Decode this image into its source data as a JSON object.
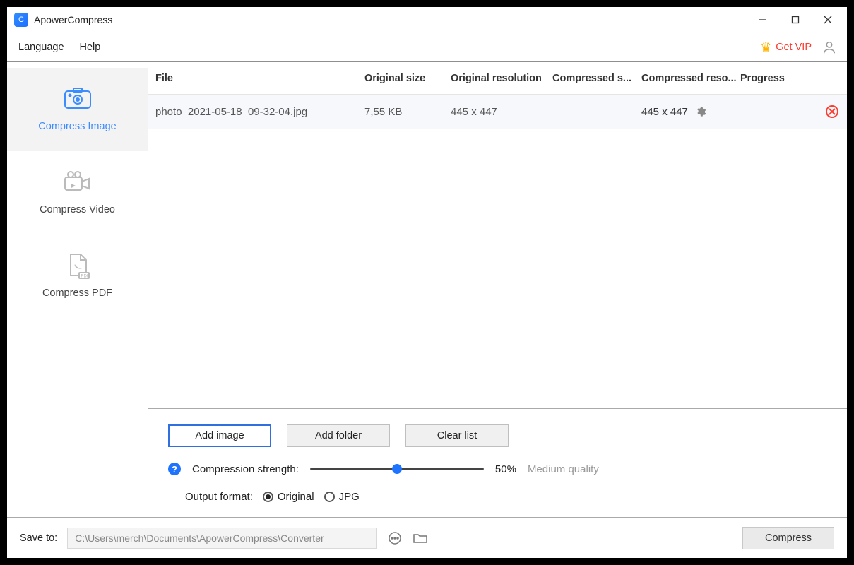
{
  "app": {
    "title": "ApowerCompress"
  },
  "window_controls": {
    "minimize": "min",
    "maximize": "max",
    "close": "close"
  },
  "menubar": {
    "items": [
      "Language",
      "Help"
    ],
    "vip_label": "Get VIP"
  },
  "sidebar": {
    "items": [
      {
        "label": "Compress Image",
        "icon": "camera-icon",
        "active": true
      },
      {
        "label": "Compress Video",
        "icon": "video-icon",
        "active": false
      },
      {
        "label": "Compress PDF",
        "icon": "pdf-icon",
        "active": false
      }
    ]
  },
  "table": {
    "headers": {
      "file": "File",
      "original_size": "Original size",
      "original_resolution": "Original resolution",
      "compressed_size": "Compressed s...",
      "compressed_resolution": "Compressed reso...",
      "progress": "Progress"
    },
    "rows": [
      {
        "file": "photo_2021-05-18_09-32-04.jpg",
        "original_size": "7,55 KB",
        "original_resolution": "445 x 447",
        "compressed_size": "",
        "compressed_resolution": "445 x 447",
        "progress": ""
      }
    ]
  },
  "actions": {
    "add_image": "Add image",
    "add_folder": "Add folder",
    "clear_list": "Clear list"
  },
  "compression": {
    "label": "Compression strength:",
    "value_percent": 50,
    "value_label": "50%",
    "quality_label": "Medium quality"
  },
  "output_format": {
    "label": "Output format:",
    "options": [
      "Original",
      "JPG"
    ],
    "selected": "Original"
  },
  "footer": {
    "save_to_label": "Save to:",
    "path": "C:\\Users\\merch\\Documents\\ApowerCompress\\Converter",
    "compress_label": "Compress"
  }
}
